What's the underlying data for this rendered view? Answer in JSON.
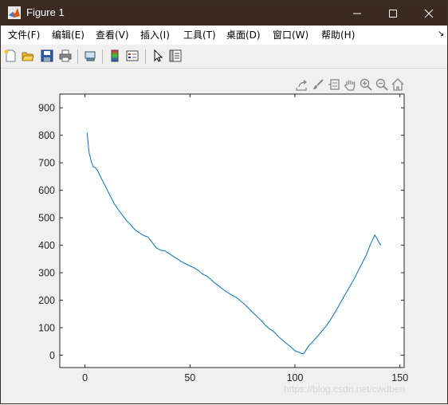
{
  "window": {
    "title": "Figure 1",
    "controls": [
      "minimize-icon",
      "maximize-icon",
      "close-icon"
    ]
  },
  "menu": [
    {
      "label": "文件(F)"
    },
    {
      "label": "编辑(E)"
    },
    {
      "label": "查看(V)"
    },
    {
      "label": "插入(I)"
    },
    {
      "label": "工具(T)"
    },
    {
      "label": "桌面(D)"
    },
    {
      "label": "窗口(W)"
    },
    {
      "label": "帮助(H)"
    }
  ],
  "toolbar": [
    "new-figure-icon",
    "open-file-icon",
    "save-icon",
    "print-icon",
    "link-plot-icon",
    "colorbar-icon",
    "legend-icon",
    "pointer-icon",
    "property-inspector-icon"
  ],
  "axes_toolbar": [
    "export-icon",
    "brush-icon",
    "data-tips-icon",
    "pan-icon",
    "zoom-in-icon",
    "zoom-out-icon",
    "home-icon"
  ],
  "watermark": "https://blog.csdn.net/cwdben",
  "chart_data": {
    "type": "line",
    "series_color": "#0072bd",
    "xlim": [
      -12,
      152
    ],
    "ylim": [
      -45,
      950
    ],
    "xticks": [
      0,
      50,
      100,
      150
    ],
    "yticks": [
      0,
      100,
      200,
      300,
      400,
      500,
      600,
      700,
      800,
      900
    ],
    "grid": false,
    "x": [
      1,
      2,
      3,
      4,
      5,
      6,
      8,
      10,
      12,
      14,
      16,
      18,
      20,
      22,
      24,
      26,
      28,
      30,
      32,
      34,
      36,
      38,
      40,
      42,
      44,
      46,
      48,
      50,
      52,
      54,
      56,
      58,
      60,
      62,
      64,
      66,
      68,
      70,
      72,
      74,
      76,
      78,
      80,
      82,
      84,
      86,
      88,
      90,
      92,
      94,
      96,
      98,
      100,
      102,
      103,
      104,
      105,
      106,
      107,
      108,
      110,
      112,
      114,
      116,
      118,
      120,
      122,
      124,
      126,
      128,
      130,
      132,
      134,
      136,
      137,
      138,
      139,
      140,
      141
    ],
    "y": [
      810,
      735,
      705,
      685,
      682,
      672,
      640,
      610,
      580,
      550,
      528,
      508,
      488,
      472,
      455,
      445,
      435,
      430,
      410,
      390,
      382,
      380,
      370,
      360,
      350,
      340,
      332,
      325,
      318,
      308,
      295,
      288,
      275,
      262,
      250,
      238,
      228,
      218,
      210,
      198,
      185,
      170,
      155,
      140,
      126,
      108,
      95,
      85,
      68,
      55,
      42,
      30,
      16,
      10,
      6,
      5,
      15,
      28,
      38,
      45,
      62,
      80,
      98,
      118,
      142,
      168,
      195,
      222,
      248,
      275,
      305,
      335,
      365,
      405,
      420,
      437,
      425,
      410,
      400
    ]
  }
}
